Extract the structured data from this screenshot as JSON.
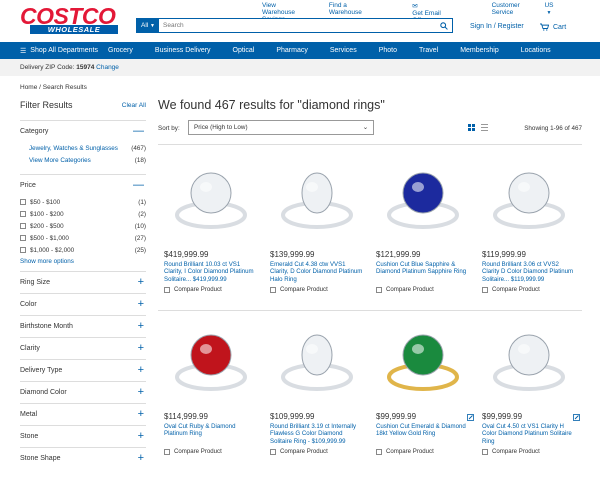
{
  "header": {
    "logo_top": "COSTCO",
    "logo_bottom": "WHOLESALE",
    "top_links": [
      "View Warehouse Savings",
      "Find a Warehouse",
      "Get Email Offers",
      "Customer Service",
      "US"
    ],
    "search_category": "All",
    "search_placeholder": "Search",
    "account": "Sign In / Register",
    "cart": "Cart"
  },
  "nav": {
    "all_departments": "Shop All Departments",
    "items": [
      "Grocery",
      "Business Delivery",
      "Optical",
      "Pharmacy",
      "Services",
      "Photo",
      "Travel",
      "Membership",
      "Locations"
    ]
  },
  "zip": {
    "label": "Delivery ZIP Code:",
    "code": "15974",
    "change": "Change"
  },
  "breadcrumb": {
    "home": "Home",
    "sep": "/",
    "current": "Search Results"
  },
  "filters": {
    "title": "Filter Results",
    "clear": "Clear All",
    "category": {
      "title": "Category",
      "rows": [
        {
          "label": "Jewelry, Watches & Sunglasses",
          "count": "(467)"
        },
        {
          "label": "View More Categories",
          "count": "(18)"
        }
      ]
    },
    "price": {
      "title": "Price",
      "rows": [
        {
          "label": "$50 - $100",
          "count": "(1)"
        },
        {
          "label": "$100 - $200",
          "count": "(2)"
        },
        {
          "label": "$200 - $500",
          "count": "(10)"
        },
        {
          "label": "$500 - $1,000",
          "count": "(27)"
        },
        {
          "label": "$1,000 - $2,000",
          "count": "(25)"
        }
      ],
      "more": "Show more options"
    },
    "collapsed": [
      "Ring Size",
      "Color",
      "Birthstone Month",
      "Clarity",
      "Delivery Type",
      "Diamond Color",
      "Metal",
      "Stone",
      "Stone Shape"
    ]
  },
  "results": {
    "headline": "We found 467 results for \"diamond rings\"",
    "sort_label": "Sort by:",
    "sort_value": "Price (High to Low)",
    "showing": "Showing 1-96 of 467",
    "compare_label": "Compare Product",
    "row1": [
      {
        "price": "$419,999.99",
        "desc": "Round Brilliant 10.03 ct VS1 Clarity, I Color Diamond Platinum Solitaire... $419,999.99",
        "stone": "#eef1f4",
        "metal": "#d9dde2"
      },
      {
        "price": "$139,999.99",
        "desc": "Emerald Cut 4.38 ctw VVS1 Clarity, D Color Diamond Platinum Halo Ring",
        "stone": "#eef1f4",
        "metal": "#d9dde2"
      },
      {
        "price": "$121,999.99",
        "desc": "Cushion Cut Blue Sapphire & Diamond Platinum Sapphire Ring",
        "stone": "#1c2a9e",
        "metal": "#d9dde2"
      },
      {
        "price": "$119,999.99",
        "desc": "Round Brilliant 3.06 ct VVS2 Clarity D Color Diamond Platinum Solitaire... $119,999.99",
        "stone": "#eef1f4",
        "metal": "#d9dde2"
      }
    ],
    "row2": [
      {
        "price": "$114,999.99",
        "desc": "Oval Cut Ruby & Diamond Platinum Ring",
        "stone": "#c0141c",
        "metal": "#d9dde2"
      },
      {
        "price": "$109,999.99",
        "desc": "Round Brilliant 3.19 ct Internally Flawless G Color Diamond Solitaire Ring - $109,999.99",
        "stone": "#eef1f4",
        "metal": "#d9dde2"
      },
      {
        "price": "$99,999.99",
        "desc": "Cushion Cut Emerald & Diamond 18kt Yellow Gold Ring",
        "stone": "#1a8a3e",
        "metal": "#e0b54a"
      },
      {
        "price": "$99,999.99",
        "desc": "Oval Cut 4.50 ct VS1 Clarity H Color Diamond Platinum Solitaire Ring",
        "stone": "#eef1f4",
        "metal": "#d9dde2"
      }
    ]
  },
  "colors": {
    "brand_red": "#e31837",
    "brand_blue": "#0060a9"
  }
}
